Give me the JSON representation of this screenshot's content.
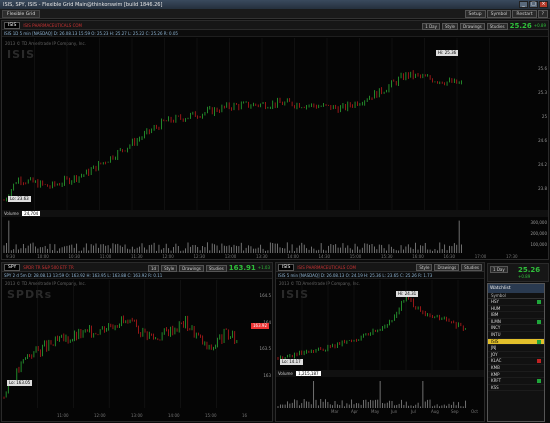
{
  "window": {
    "title": "ISIS, SPY, ISIS - Flexible Grid Main@thinkorswim [build 1846.26]",
    "buttons": [
      "_",
      "□",
      "×"
    ]
  },
  "toolbar": {
    "tab": "Flexible Grid",
    "right_buttons": [
      "Setup",
      "Symbol",
      "Restart",
      "?"
    ]
  },
  "top_chart": {
    "symbol": "ISIS",
    "red_label": "ISIS PHARMACEUTICALS COM",
    "period": "1 Day",
    "style": "Style",
    "drawings": "Drawings",
    "studies": "Studies",
    "price": "25.26",
    "change": "+0.89",
    "quote_line": "ISIS 1D 5 min [NASDAQ]   D: 26.08.13 15:59   O: 25.23   H: 25.27   L: 25.22   C: 25.26   R: 0.05",
    "copyright": "2013 © TD Ameritrade IP Company, Inc.",
    "watermark": "ISIS",
    "hi_tag": "Hi: 25.36",
    "lo_tag": "Lo: 23.63",
    "y_labels": [
      "25.6",
      "25.3",
      "25",
      "24.6",
      "24.2",
      "23.8"
    ],
    "x_labels": [
      "9:30",
      "10:00",
      "10:30",
      "11:00",
      "11:30",
      "12:00",
      "12:30",
      "13:00",
      "13:30",
      "14:00",
      "14:30",
      "15:00",
      "15:30",
      "16:00",
      "16:30",
      "17:00",
      "17:30"
    ],
    "volume_label": "Volume",
    "volume_value": "24,704",
    "vol_labels": [
      "300,000",
      "200,000",
      "100,000"
    ]
  },
  "bottom_left_chart": {
    "symbol": "SPY",
    "red_label": "SPDR TR S&P 500 ETF TR",
    "period": "1d",
    "style": "Style",
    "drawings": "Drawings",
    "studies": "Studies",
    "price": "163.91",
    "change": "+1.03",
    "quote_line": "SPY 2 d 5m   D: 28.08.13 13:59   O: 163.92   H: 163.95   L: 163.88   C: 163.92   R: 0.11",
    "copyright": "2013 © TD Ameritrade IP Company, Inc.",
    "watermark": "SPDRs",
    "lo_tag": "Lo: 163.05",
    "last_tag": "163.92",
    "y_labels": [
      "164.5",
      "164",
      "163.5",
      "163"
    ],
    "x_labels": [
      "11:00",
      "12:00",
      "13:00",
      "14:00",
      "15:00",
      "16"
    ]
  },
  "bottom_right_chart": {
    "symbol": "ISIS",
    "red_label": "ISIS PHARMACEUTICALS COM",
    "period": "1 Day",
    "style": "Style",
    "drawings": "Drawings",
    "studies": "Studies",
    "price": "25.26",
    "change": "+0.89",
    "quote_line": "ISIS 5 min [NASDAQ]   D: 26.08.13   O: 24.19   H: 25.36   L: 23.65   C: 25.26   R: 1.73",
    "copyright": "2013 © TD Ameritrade IP Company, Inc.",
    "watermark": "ISIS",
    "hi_tag": "Hi: 24.31",
    "lo_tag": "Lo: 14.17",
    "volume_label": "Volume",
    "volume_value": "1,215,187",
    "x_labels": [
      "Mar",
      "Apr",
      "May",
      "Jun",
      "Jul",
      "Aug",
      "Sep",
      "Oct"
    ]
  },
  "watchlist": {
    "title": "Watchlist",
    "column": "Symbol",
    "rows": [
      "HSY",
      "HUM",
      "IBM",
      "ILMN",
      "INCY",
      "INTU",
      "ISIS",
      "JNJ",
      "JOY",
      "KLAC",
      "KMB",
      "KMP",
      "KRFT",
      "KSS"
    ],
    "highlighted": "ISIS"
  }
}
